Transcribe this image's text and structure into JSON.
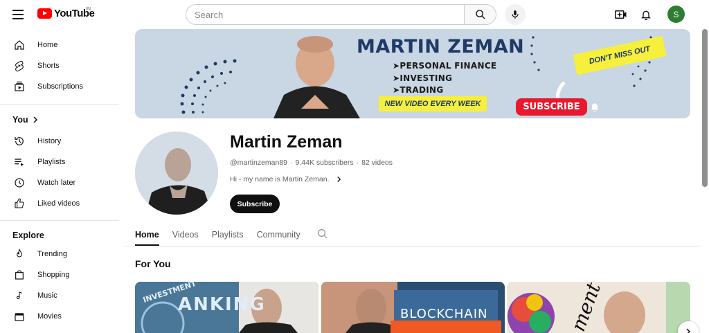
{
  "header": {
    "logo_text": "YouTube",
    "country_code": "IN",
    "search_placeholder": "Search",
    "avatar_letter": "S",
    "avatar_color": "#2e7d32"
  },
  "sidebar": {
    "main_items": [
      {
        "label": "Home",
        "icon": "home-icon"
      },
      {
        "label": "Shorts",
        "icon": "shorts-icon"
      },
      {
        "label": "Subscriptions",
        "icon": "subscriptions-icon"
      }
    ],
    "you_heading": "You",
    "you_items": [
      {
        "label": "History",
        "icon": "history-icon"
      },
      {
        "label": "Playlists",
        "icon": "playlists-icon"
      },
      {
        "label": "Watch later",
        "icon": "clock-icon"
      },
      {
        "label": "Liked videos",
        "icon": "thumbs-up-icon"
      }
    ],
    "explore_heading": "Explore",
    "explore_items": [
      {
        "label": "Trending",
        "icon": "flame-icon"
      },
      {
        "label": "Shopping",
        "icon": "shopping-bag-icon"
      },
      {
        "label": "Music",
        "icon": "music-note-icon"
      },
      {
        "label": "Movies",
        "icon": "clapperboard-icon"
      }
    ]
  },
  "banner": {
    "name": "MARTIN ZEMAN",
    "lines": [
      "➤PERSONAL FINANCE",
      "➤INVESTING",
      "➤TRADING"
    ],
    "tagline": "NEW VIDEO EVERY WEEK",
    "subscribe": "SUBSCRIBE",
    "dont_miss": "DON'T MISS OUT",
    "bg_color": "#c9d6e3",
    "accent_color": "#1e3a66"
  },
  "channel": {
    "name": "Martin Zeman",
    "handle": "@martinzeman89",
    "subscribers": "9.44K subscribers",
    "videos": "82 videos",
    "separator": "·",
    "description": "Hi - my name is Martin Zeman.",
    "subscribe_label": "Subscribe"
  },
  "tabs": [
    {
      "label": "Home",
      "active": true
    },
    {
      "label": "Videos",
      "active": false
    },
    {
      "label": "Playlists",
      "active": false
    },
    {
      "label": "Community",
      "active": false
    }
  ],
  "section": {
    "title": "For You"
  },
  "thumbnails": [
    {
      "text_top": "INVESTMENT",
      "text_main": "ANKING",
      "bg": "#3c6a8e"
    },
    {
      "text_top": "",
      "text_main": "BLOCKCHAIN",
      "bg": "#1f3f63"
    },
    {
      "text_top": "",
      "text_main": "ment",
      "bg": "#e8ddd0"
    }
  ]
}
